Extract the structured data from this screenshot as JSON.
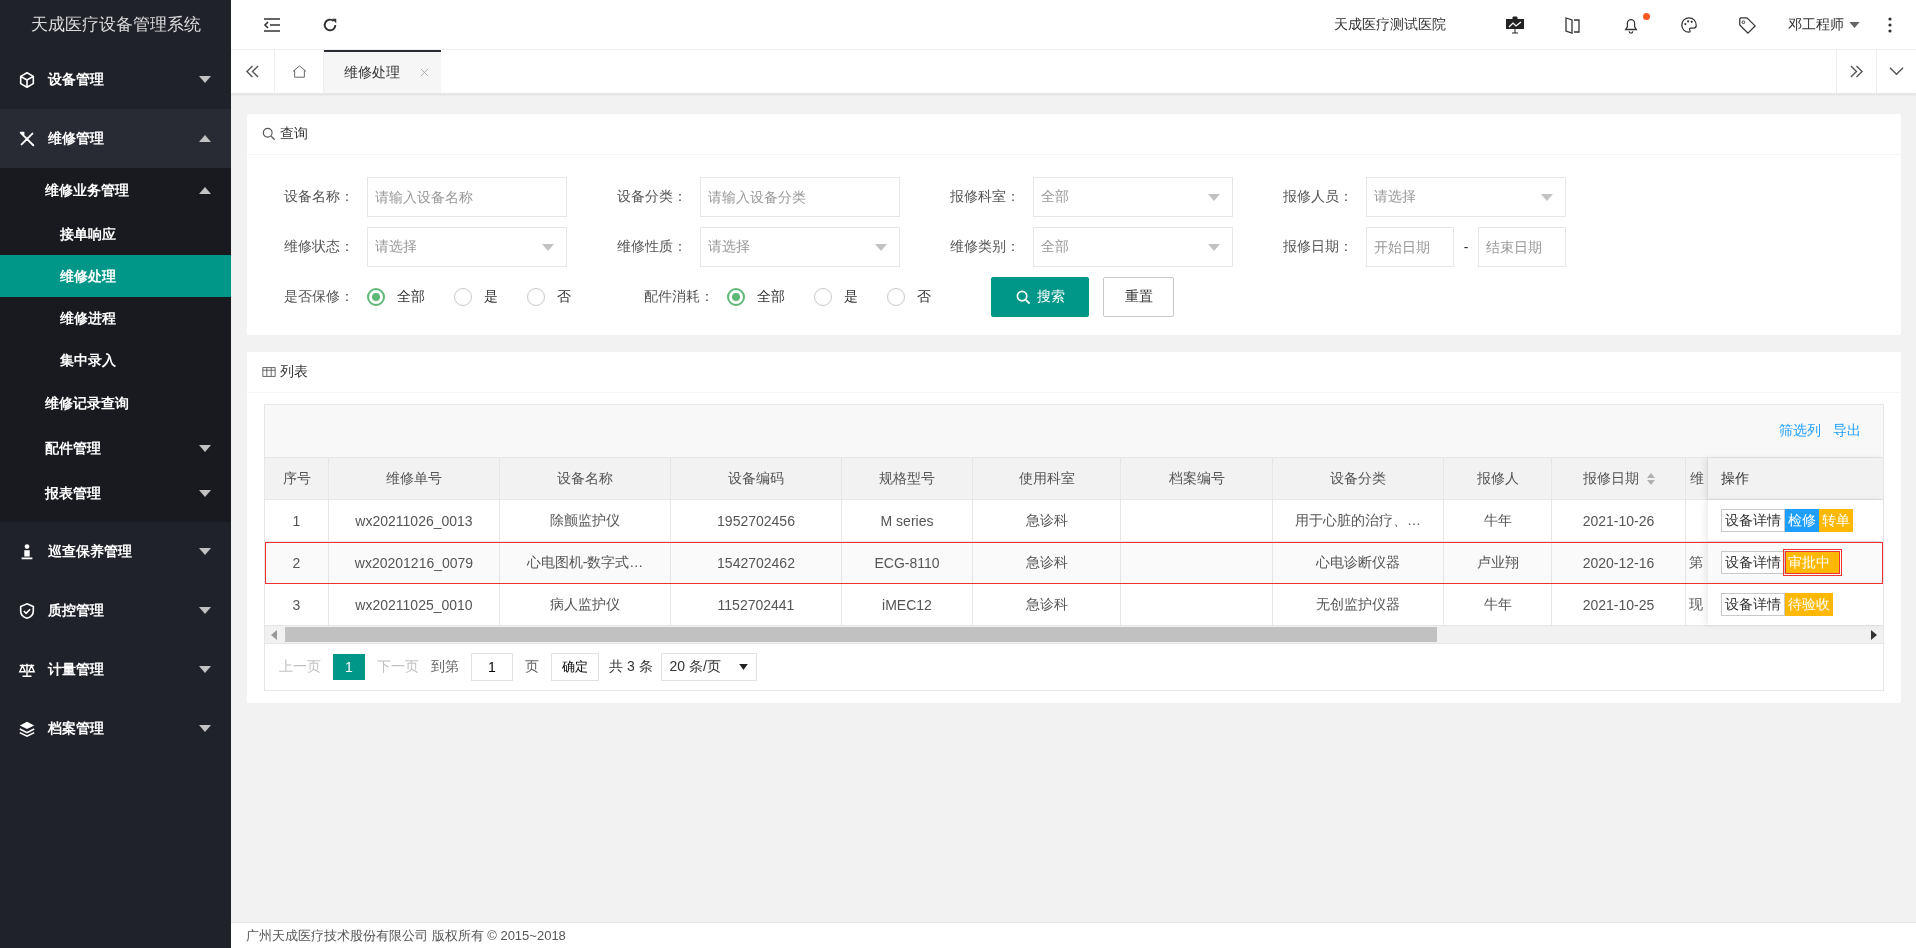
{
  "app_title": "天成医疗设备管理系统",
  "sidebar": {
    "items": [
      {
        "label": "设备管理",
        "expanded": false
      },
      {
        "label": "维修管理",
        "expanded": true,
        "children": [
          {
            "label": "维修业务管理",
            "expanded": true,
            "children": [
              {
                "label": "接单响应",
                "selected": false
              },
              {
                "label": "维修处理",
                "selected": true
              },
              {
                "label": "维修进程",
                "selected": false
              },
              {
                "label": "集中录入",
                "selected": false
              }
            ]
          },
          {
            "label": "维修记录查询"
          },
          {
            "label": "配件管理",
            "expanded": false
          },
          {
            "label": "报表管理",
            "expanded": false
          }
        ]
      },
      {
        "label": "巡查保养管理",
        "expanded": false
      },
      {
        "label": "质控管理",
        "expanded": false
      },
      {
        "label": "计量管理",
        "expanded": false
      },
      {
        "label": "档案管理",
        "expanded": false
      }
    ]
  },
  "header": {
    "hospital": "天成医疗测试医院",
    "user": "邓工程师",
    "notifications_unread": true
  },
  "tabs": [
    {
      "label": "维修处理",
      "selected": true
    }
  ],
  "query": {
    "title": "查询",
    "fields": [
      {
        "label": "设备名称：",
        "kind": "text",
        "placeholder": "请输入设备名称"
      },
      {
        "label": "设备分类：",
        "kind": "text",
        "placeholder": "请输入设备分类"
      },
      {
        "label": "报修科室：",
        "kind": "select",
        "placeholder": "全部"
      },
      {
        "label": "报修人员：",
        "kind": "select",
        "placeholder": "请选择"
      },
      {
        "label": "维修状态：",
        "kind": "select",
        "placeholder": "请选择"
      },
      {
        "label": "维修性质：",
        "kind": "select",
        "placeholder": "请选择"
      },
      {
        "label": "维修类别：",
        "kind": "select",
        "placeholder": "全部"
      },
      {
        "label": "报修日期：",
        "kind": "daterange",
        "start_placeholder": "开始日期",
        "separator": "-",
        "end_placeholder": "结束日期"
      }
    ],
    "radio_groups": [
      {
        "label": "是否保修：",
        "options": [
          {
            "label": "全部",
            "selected": true
          },
          {
            "label": "是",
            "selected": false
          },
          {
            "label": "否",
            "selected": false
          }
        ]
      },
      {
        "label": "配件消耗：",
        "options": [
          {
            "label": "全部",
            "selected": true
          },
          {
            "label": "是",
            "selected": false
          },
          {
            "label": "否",
            "selected": false
          }
        ]
      }
    ],
    "buttons": [
      {
        "label": "搜索",
        "kind": "primary"
      },
      {
        "label": "重置",
        "kind": "default"
      }
    ]
  },
  "list": {
    "title": "列表",
    "tools": [
      "筛选列",
      "导出"
    ],
    "columns": [
      {
        "label": "序号",
        "sortable": false
      },
      {
        "label": "维修单号",
        "sortable": false
      },
      {
        "label": "设备名称",
        "sortable": false
      },
      {
        "label": "设备编码",
        "sortable": false
      },
      {
        "label": "规格型号",
        "sortable": false
      },
      {
        "label": "使用科室",
        "sortable": false
      },
      {
        "label": "档案编号",
        "sortable": false
      },
      {
        "label": "设备分类",
        "sortable": false
      },
      {
        "label": "报修人",
        "sortable": false
      },
      {
        "label": "报修日期",
        "sortable": true
      },
      {
        "label": "维",
        "sortable": false
      }
    ],
    "action_column": "操作",
    "rows": [
      {
        "selected": false,
        "cells": [
          "1",
          "wx20211026_0013",
          "除颤监护仪",
          "1952702456",
          "M series",
          "急诊科",
          null,
          "用于心脏的治疗、…",
          "牛年",
          "2021-10-26",
          null
        ],
        "actions": [
          {
            "label": "设备详情",
            "kind": "default",
            "flagged": false
          },
          {
            "label": "检修",
            "kind": "normal",
            "flagged": false
          },
          {
            "label": "转单",
            "kind": "warm",
            "flagged": false
          }
        ]
      },
      {
        "selected": true,
        "cells": [
          "2",
          "wx20201216_0079",
          "心电图机-数字式…",
          "1542702462",
          "ECG-8110",
          "急诊科",
          null,
          "心电诊断仪器",
          "卢业翔",
          "2020-12-16",
          "第"
        ],
        "actions": [
          {
            "label": "设备详情",
            "kind": "default",
            "flagged": false
          },
          {
            "label": "审批中",
            "kind": "warm",
            "flagged": true
          }
        ]
      },
      {
        "selected": false,
        "cells": [
          "3",
          "wx20211025_0010",
          "病人监护仪",
          "1152702441",
          "iMEC12",
          "急诊科",
          null,
          "无创监护仪器",
          "牛年",
          "2021-10-25",
          "现"
        ],
        "actions": [
          {
            "label": "设备详情",
            "kind": "default",
            "flagged": false
          },
          {
            "label": "待验收",
            "kind": "warm",
            "flagged": false
          }
        ]
      }
    ],
    "pagination": {
      "prev": {
        "label": "上一页",
        "disabled": true
      },
      "pages": [
        {
          "label": "1",
          "selected": true
        }
      ],
      "next": {
        "label": "下一页",
        "disabled": true
      },
      "goto_label": "到第",
      "goto_value": "1",
      "page_unit": "页",
      "confirm": "确定",
      "total": "共 3 条",
      "page_size": "20 条/页"
    }
  },
  "footer": "广州天成医疗技术股份有限公司 版权所有 © 2015~2018"
}
